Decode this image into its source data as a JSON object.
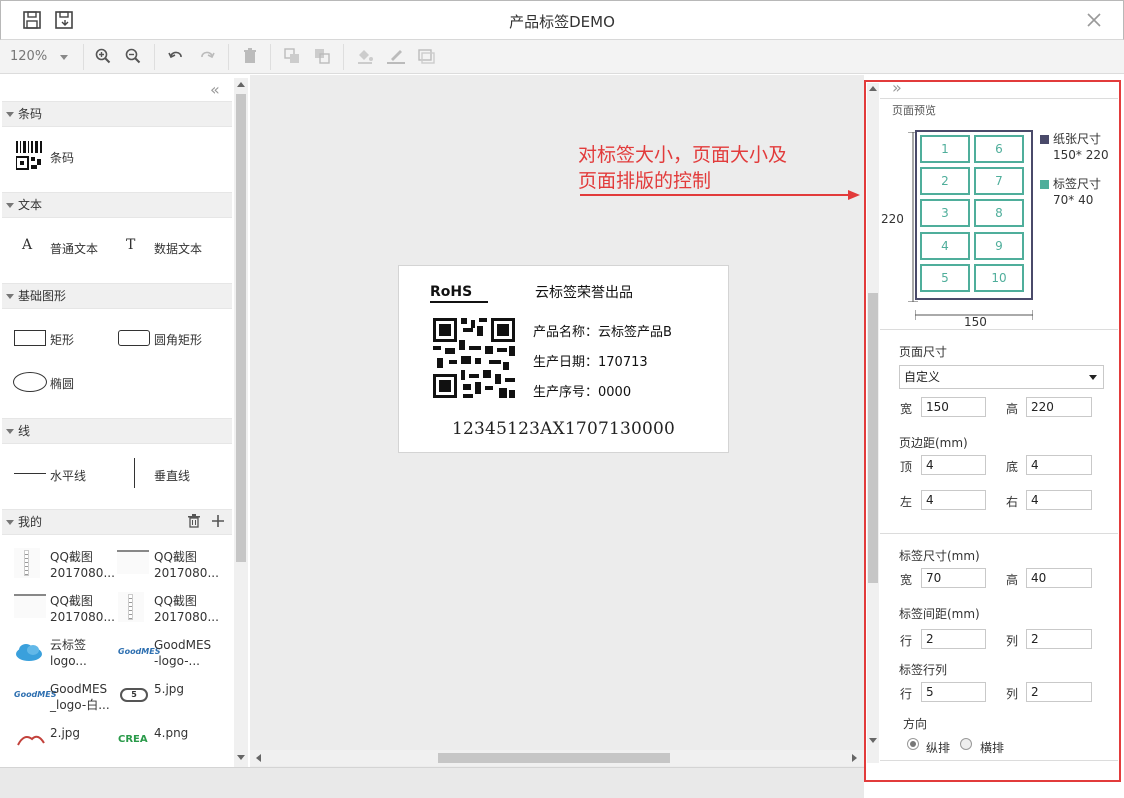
{
  "window": {
    "title": "产品标签DEMO"
  },
  "toolbar": {
    "zoom": "120%"
  },
  "palette": {
    "collapse_glyph": "«",
    "sections": {
      "barcode": "条码",
      "text": "文本",
      "shapes": "基础图形",
      "lines": "线",
      "mine": "我的"
    },
    "items": {
      "barcode": "条码",
      "plain_text": "普通文本",
      "data_text": "数据文本",
      "rect": "矩形",
      "rounded_rect": "圆角矩形",
      "ellipse": "椭圆",
      "hline": "水平线",
      "vline": "垂直线"
    },
    "mine_items": [
      {
        "line1": "QQ截图",
        "line2": "2017080..."
      },
      {
        "line1": "QQ截图",
        "line2": "2017080..."
      },
      {
        "line1": "QQ截图",
        "line2": "2017080..."
      },
      {
        "line1": "QQ截图",
        "line2": "2017080..."
      },
      {
        "line1": "云标签",
        "line2": "logo..."
      },
      {
        "line1": "GoodMES",
        "line2": "-logo-..."
      },
      {
        "line1": "GoodMES",
        "line2": "_logo-白..."
      },
      {
        "line1": "5.jpg",
        "line2": ""
      },
      {
        "line1": "2.jpg",
        "line2": ""
      },
      {
        "line1": "4.png",
        "line2": ""
      }
    ],
    "thumb_texts": {
      "goodmes": "GoodMES",
      "crea": "CREA",
      "num5": "5"
    }
  },
  "label": {
    "rohs": "RoHS",
    "slogan": "云标签荣誉出品",
    "product": "产品名称：云标签产品B",
    "date": "生产日期：170713",
    "serial": "生产序号：0000",
    "barcode_text": "12345123AX1707130000"
  },
  "annotation": {
    "line1": "对标签大小，页面大小及",
    "line2": "页面排版的控制",
    "color": "#e23b3b"
  },
  "panel": {
    "expand_glyph": "»",
    "preview_title": "页面预览",
    "cells": [
      "1",
      "6",
      "2",
      "7",
      "3",
      "8",
      "4",
      "9",
      "5",
      "10"
    ],
    "paper_legend": "纸张尺寸",
    "paper_size": "150* 220",
    "label_legend": "标签尺寸",
    "label_size": "70* 40",
    "height_dim": "220",
    "width_dim": "150",
    "page_size_title": "页面尺寸",
    "page_size_select": "自定义",
    "width_label": "宽",
    "width_value": "150",
    "height_label": "高",
    "height_value": "220",
    "margin_title": "页边距(mm)",
    "top_label": "顶",
    "top_value": "4",
    "bottom_label": "底",
    "bottom_value": "4",
    "left_label": "左",
    "left_value": "4",
    "right_label": "右",
    "right_value": "4",
    "label_size_title": "标签尺寸(mm)",
    "lw_label": "宽",
    "lw_value": "70",
    "lh_label": "高",
    "lh_value": "40",
    "gap_title": "标签间距(mm)",
    "gr_label": "行",
    "gr_value": "2",
    "gc_label": "列",
    "gc_value": "2",
    "rc_title": "标签行列",
    "rr_label": "行",
    "rr_value": "5",
    "rcl_label": "列",
    "rcl_value": "2",
    "dir_title": "方向",
    "dir_vertical": "纵排",
    "dir_horizontal": "横排",
    "colors": {
      "paper": "#4a4a6a",
      "label": "#4fae9b"
    }
  }
}
